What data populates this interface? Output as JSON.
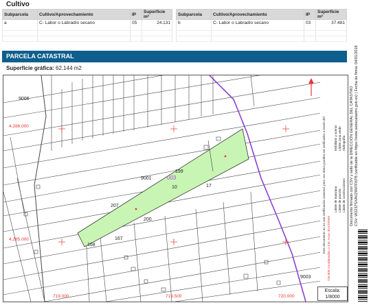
{
  "cultivo": {
    "title": "Cultivo",
    "headers": [
      "Subparcela",
      "Cultivo/Aprovechamiento",
      "IP",
      "Superficie m²"
    ],
    "left_row": [
      "a",
      "C- Labor o Labradío secano",
      "05",
      "24.131"
    ],
    "right_row": [
      "b",
      "C- Labor o Labradío secano",
      "03",
      "37.481"
    ]
  },
  "parcela": {
    "banner": "PARCELA CATASTRAL",
    "superficie_label": "Superficie gráfica:",
    "superficie_value": "62.144 m2"
  },
  "map": {
    "parcel_fill": "#c8f5b4",
    "parcel_id": "003",
    "boundary_color": "#8a3fd0",
    "labels": {
      "p9006": "9006",
      "p9003": "9003",
      "p9001": "9001",
      "p199": "199",
      "p10": "10",
      "p17": "17",
      "p207": "207",
      "p200": "200",
      "p167": "167",
      "p168": "168",
      "p9003b": "9003"
    },
    "coords": {
      "y1": "4.286.000",
      "y2": "4.285.000",
      "x1": "719.000",
      "x2": "719.500",
      "x3": "720.000"
    },
    "scale_label": "Escala:",
    "scale_value": "1/8000"
  },
  "legend": {
    "items": [
      "Límite de manzana",
      "Límite de parcela",
      "Límite de construcciones",
      "Mobiliario y aceras",
      "Límite zona verde",
      "Hidrografía"
    ],
    "coord_note": "726.000 Coordenadas U.T.M. Huso 30 ETRS89",
    "coord_note2": "Este documento no es una certificación catastral, pero sus datos pueden ser verificados a través del"
  },
  "side": {
    "line1": "Documento firmado con CSV y sello de la DIRECCIÓN GENERAL DEL CATASTRO",
    "line2": "CSV: W2237SXAVZ9M7FKP8 (verificable en https://www.sedecatastro.gob.es) | Fecha de firma: 04/01/2018"
  }
}
